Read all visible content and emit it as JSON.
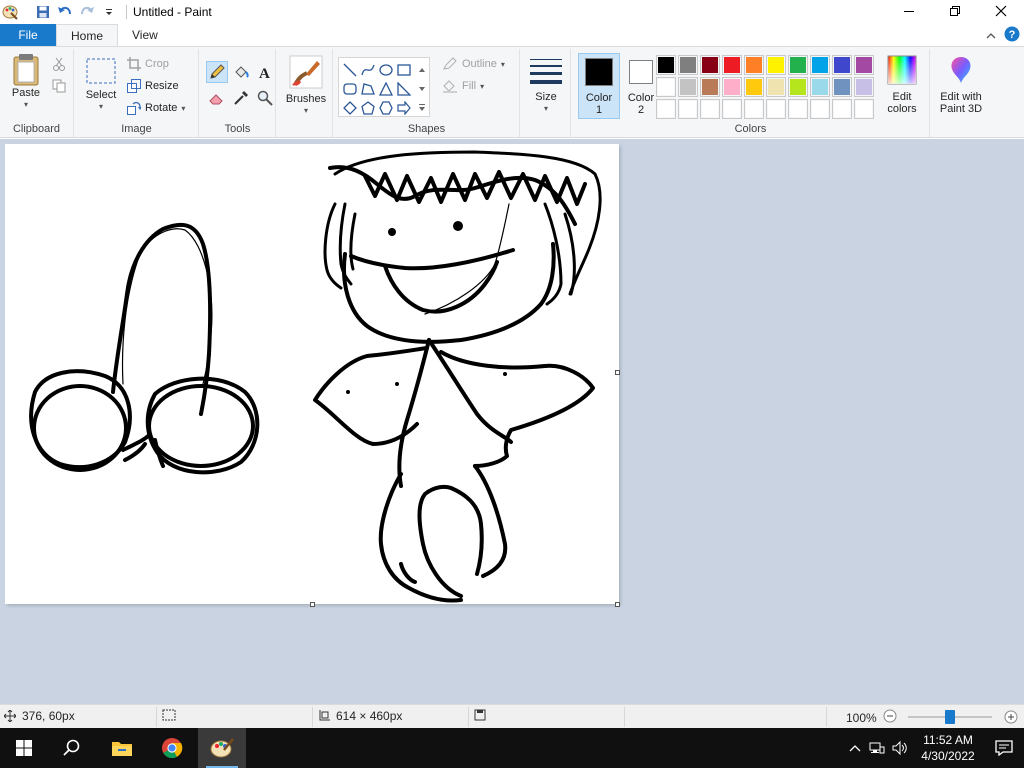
{
  "window": {
    "title": "Untitled - Paint"
  },
  "tabs": {
    "file": "File",
    "home": "Home",
    "view": "View"
  },
  "ribbon": {
    "clipboard": {
      "label": "Clipboard",
      "paste": "Paste"
    },
    "image": {
      "label": "Image",
      "select": "Select",
      "crop": "Crop",
      "resize": "Resize",
      "rotate": "Rotate"
    },
    "tools": {
      "label": "Tools"
    },
    "brushes": {
      "label": "Brushes"
    },
    "shapes": {
      "label": "Shapes",
      "outline": "Outline",
      "fill": "Fill"
    },
    "size": {
      "label": "Size"
    },
    "colors": {
      "label": "Colors",
      "color1_line1": "Color",
      "color1_line2": "1",
      "color2_line1": "Color",
      "color2_line2": "2",
      "edit_line1": "Edit",
      "edit_line2": "colors",
      "paint3d_line1": "Edit with",
      "paint3d_line2": "Paint 3D",
      "color1_value": "#000000",
      "color2_value": "#ffffff",
      "palette_row1": [
        "#000000",
        "#7f7f7f",
        "#880015",
        "#ed1c24",
        "#ff7f27",
        "#fff200",
        "#22b14c",
        "#00a2e8",
        "#3f48cc",
        "#a349a4"
      ],
      "palette_row2": [
        "#ffffff",
        "#c3c3c3",
        "#b97a57",
        "#ffaec9",
        "#ffc90e",
        "#efe4b0",
        "#b5e61d",
        "#99d9ea",
        "#7092be",
        "#c8bfe7"
      ],
      "palette_row3": [
        "#ffffff",
        "#ffffff",
        "#ffffff",
        "#ffffff",
        "#ffffff",
        "#ffffff",
        "#ffffff",
        "#ffffff",
        "#ffffff",
        "#ffffff"
      ]
    }
  },
  "status": {
    "cursor_pos": "376, 60px",
    "image_size": "614 × 460px",
    "zoom": "100%",
    "zoom_level": 0.5
  },
  "taskbar": {
    "time": "11:52 AM",
    "date": "4/30/2022"
  }
}
